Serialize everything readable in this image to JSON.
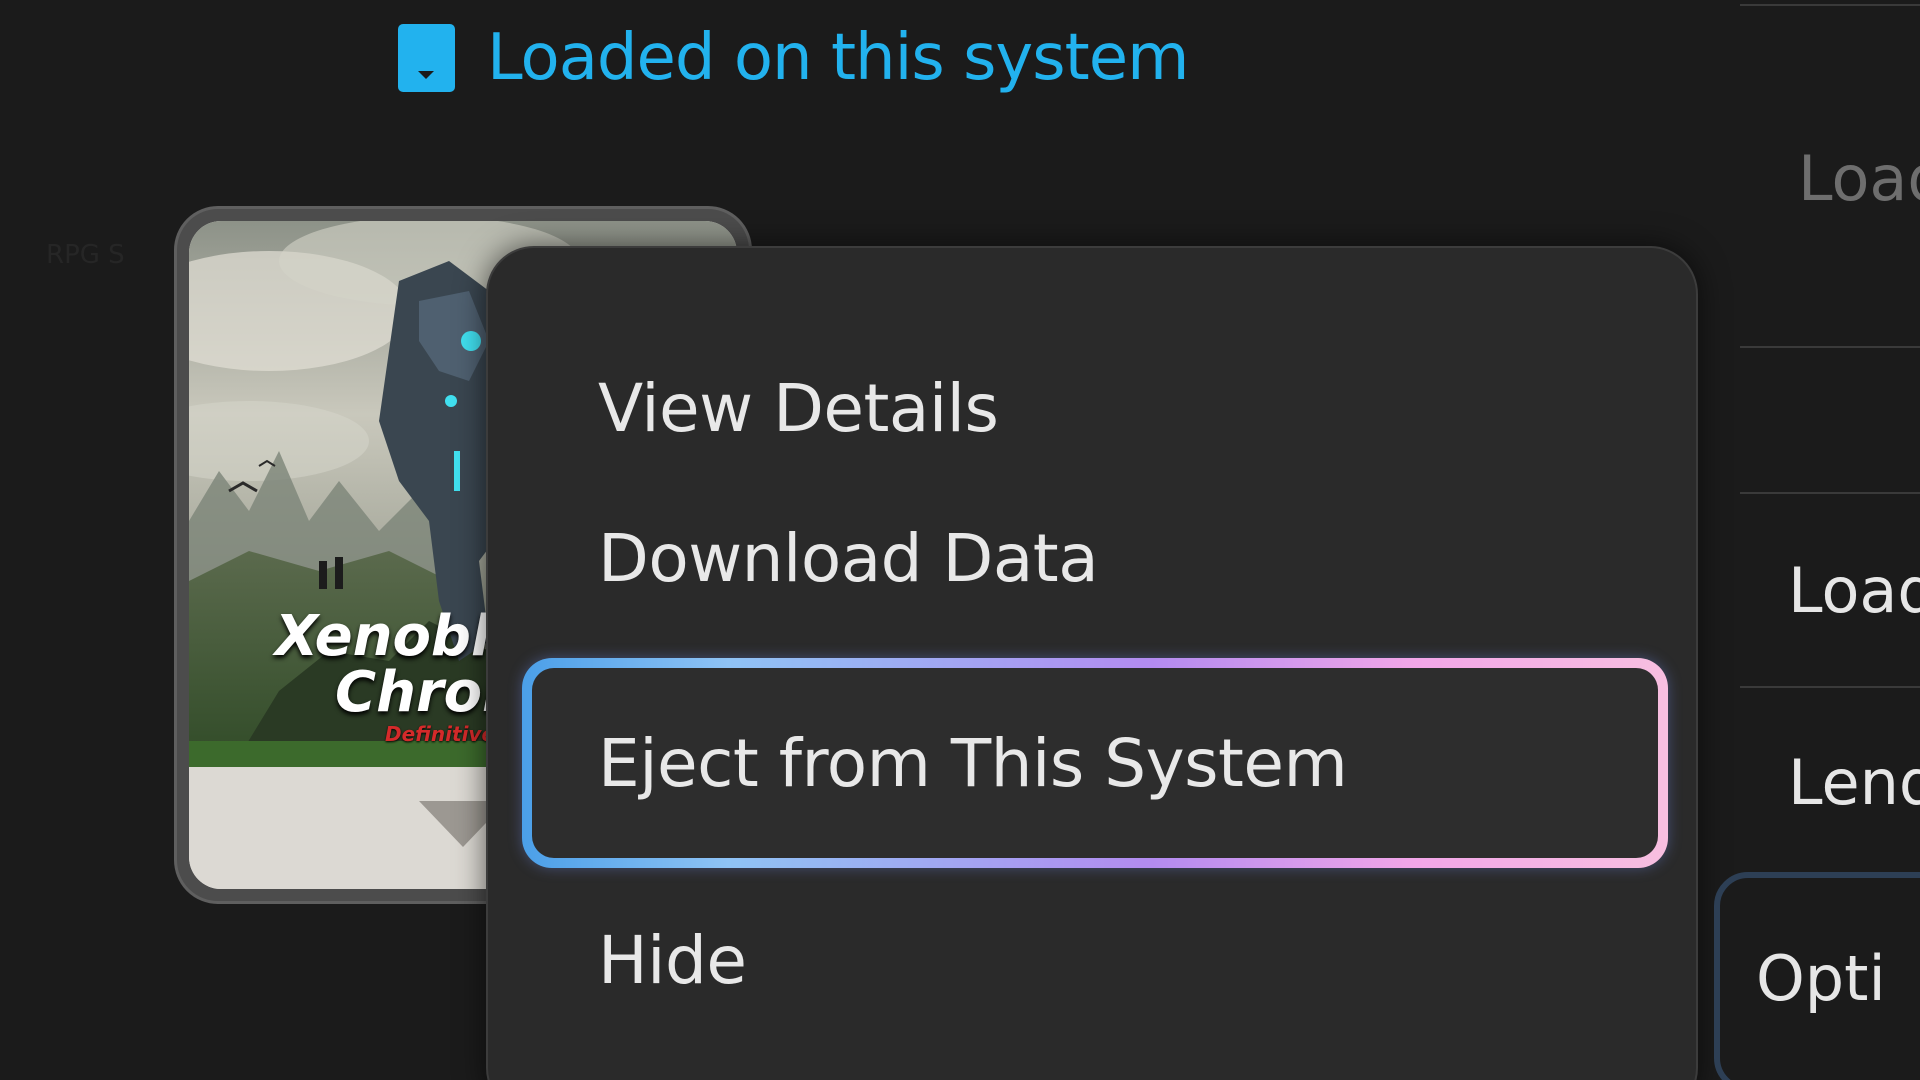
{
  "header": {
    "status_text": "Loaded on this system",
    "status_icon": "game-card-icon",
    "accent_color": "#22b2ee"
  },
  "background": {
    "genre_tag": "RPG S"
  },
  "game_card": {
    "cover_title_line1": "Xenobla",
    "cover_title_line2": "Chron",
    "cover_subtitle": "Definitive"
  },
  "context_menu": {
    "items": [
      {
        "label": "View Details"
      },
      {
        "label": "Download Data"
      },
      {
        "label": "Eject from This System",
        "selected": true
      },
      {
        "label": "Hide"
      }
    ]
  },
  "side_panel": {
    "items": [
      {
        "label": "Load"
      },
      {
        "label": "Load"
      },
      {
        "label": "Lend"
      },
      {
        "label": "Opti"
      }
    ]
  }
}
